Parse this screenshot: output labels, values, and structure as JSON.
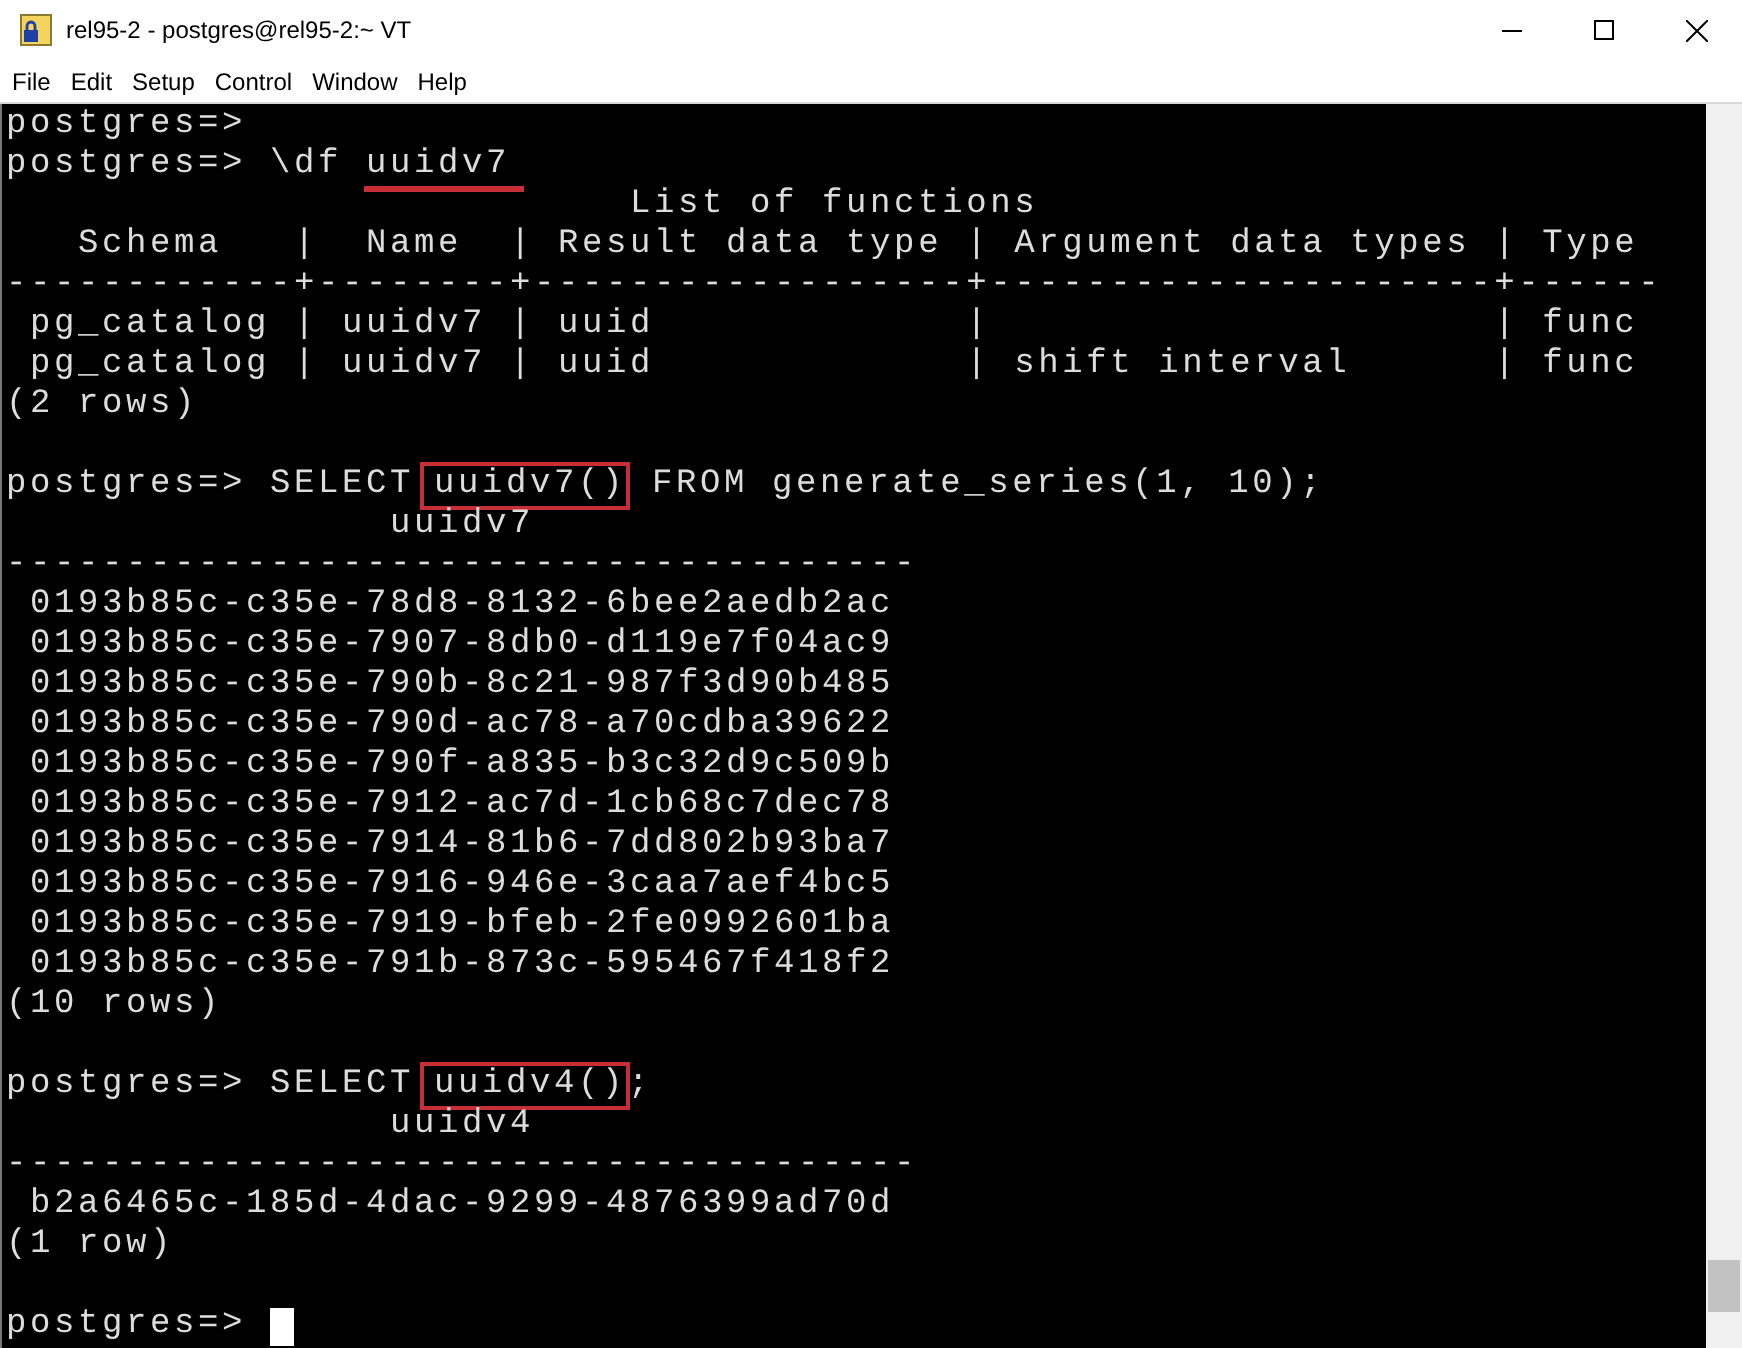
{
  "window": {
    "title": "rel95-2 - postgres@rel95-2:~ VT"
  },
  "menu": [
    "File",
    "Edit",
    "Setup",
    "Control",
    "Window",
    "Help"
  ],
  "terminal": {
    "lines": [
      {
        "kind": "text",
        "cursor": false,
        "segments": [
          {
            "kind": "plain",
            "text": "postgres=> "
          }
        ]
      },
      {
        "kind": "text",
        "cursor": false,
        "segments": [
          {
            "kind": "plain",
            "text": "postgres=> \\df "
          },
          {
            "kind": "underline",
            "text": "uuidv7"
          }
        ]
      },
      {
        "kind": "text",
        "cursor": false,
        "segments": [
          {
            "kind": "plain",
            "text": "                          List of functions"
          }
        ]
      },
      {
        "kind": "text",
        "cursor": false,
        "segments": [
          {
            "kind": "plain",
            "text": "   Schema   |  Name  | Result data type | Argument data types | Type"
          }
        ]
      },
      {
        "kind": "text",
        "cursor": false,
        "segments": [
          {
            "kind": "plain",
            "text": "------------+--------+------------------+---------------------+------"
          }
        ]
      },
      {
        "kind": "text",
        "cursor": false,
        "segments": [
          {
            "kind": "plain",
            "text": " pg_catalog | uuidv7 | uuid             |                     | func"
          }
        ]
      },
      {
        "kind": "text",
        "cursor": false,
        "segments": [
          {
            "kind": "plain",
            "text": " pg_catalog | uuidv7 | uuid             | shift interval      | func"
          }
        ]
      },
      {
        "kind": "text",
        "cursor": false,
        "segments": [
          {
            "kind": "plain",
            "text": "(2 rows)"
          }
        ]
      },
      {
        "kind": "blank",
        "cursor": false
      },
      {
        "kind": "text",
        "cursor": false,
        "segments": [
          {
            "kind": "plain",
            "text": "postgres=> SELECT "
          },
          {
            "kind": "box",
            "text": "uuidv7()"
          },
          {
            "kind": "plain",
            "text": " FROM generate_series(1, 10);"
          }
        ]
      },
      {
        "kind": "text",
        "cursor": false,
        "segments": [
          {
            "kind": "plain",
            "text": "                uuidv7"
          }
        ]
      },
      {
        "kind": "text",
        "cursor": false,
        "segments": [
          {
            "kind": "plain",
            "text": "--------------------------------------"
          }
        ]
      },
      {
        "kind": "text",
        "cursor": false,
        "segments": [
          {
            "kind": "plain",
            "text": " 0193b85c-c35e-78d8-8132-6bee2aedb2ac"
          }
        ]
      },
      {
        "kind": "text",
        "cursor": false,
        "segments": [
          {
            "kind": "plain",
            "text": " 0193b85c-c35e-7907-8db0-d119e7f04ac9"
          }
        ]
      },
      {
        "kind": "text",
        "cursor": false,
        "segments": [
          {
            "kind": "plain",
            "text": " 0193b85c-c35e-790b-8c21-987f3d90b485"
          }
        ]
      },
      {
        "kind": "text",
        "cursor": false,
        "segments": [
          {
            "kind": "plain",
            "text": " 0193b85c-c35e-790d-ac78-a70cdba39622"
          }
        ]
      },
      {
        "kind": "text",
        "cursor": false,
        "segments": [
          {
            "kind": "plain",
            "text": " 0193b85c-c35e-790f-a835-b3c32d9c509b"
          }
        ]
      },
      {
        "kind": "text",
        "cursor": false,
        "segments": [
          {
            "kind": "plain",
            "text": " 0193b85c-c35e-7912-ac7d-1cb68c7dec78"
          }
        ]
      },
      {
        "kind": "text",
        "cursor": false,
        "segments": [
          {
            "kind": "plain",
            "text": " 0193b85c-c35e-7914-81b6-7dd802b93ba7"
          }
        ]
      },
      {
        "kind": "text",
        "cursor": false,
        "segments": [
          {
            "kind": "plain",
            "text": " 0193b85c-c35e-7916-946e-3caa7aef4bc5"
          }
        ]
      },
      {
        "kind": "text",
        "cursor": false,
        "segments": [
          {
            "kind": "plain",
            "text": " 0193b85c-c35e-7919-bfeb-2fe0992601ba"
          }
        ]
      },
      {
        "kind": "text",
        "cursor": false,
        "segments": [
          {
            "kind": "plain",
            "text": " 0193b85c-c35e-791b-873c-595467f418f2"
          }
        ]
      },
      {
        "kind": "text",
        "cursor": false,
        "segments": [
          {
            "kind": "plain",
            "text": "(10 rows)"
          }
        ]
      },
      {
        "kind": "blank",
        "cursor": false
      },
      {
        "kind": "text",
        "cursor": false,
        "segments": [
          {
            "kind": "plain",
            "text": "postgres=> SELECT "
          },
          {
            "kind": "box",
            "text": "uuidv4()"
          },
          {
            "kind": "plain",
            "text": ";"
          }
        ]
      },
      {
        "kind": "text",
        "cursor": false,
        "segments": [
          {
            "kind": "plain",
            "text": "                uuidv4"
          }
        ]
      },
      {
        "kind": "text",
        "cursor": false,
        "segments": [
          {
            "kind": "plain",
            "text": "--------------------------------------"
          }
        ]
      },
      {
        "kind": "text",
        "cursor": false,
        "segments": [
          {
            "kind": "plain",
            "text": " b2a6465c-185d-4dac-9299-4876399ad70d"
          }
        ]
      },
      {
        "kind": "text",
        "cursor": false,
        "segments": [
          {
            "kind": "plain",
            "text": "(1 row)"
          }
        ]
      },
      {
        "kind": "blank",
        "cursor": false
      },
      {
        "kind": "text",
        "cursor": true,
        "segments": [
          {
            "kind": "plain",
            "text": "postgres=> "
          }
        ]
      }
    ]
  }
}
